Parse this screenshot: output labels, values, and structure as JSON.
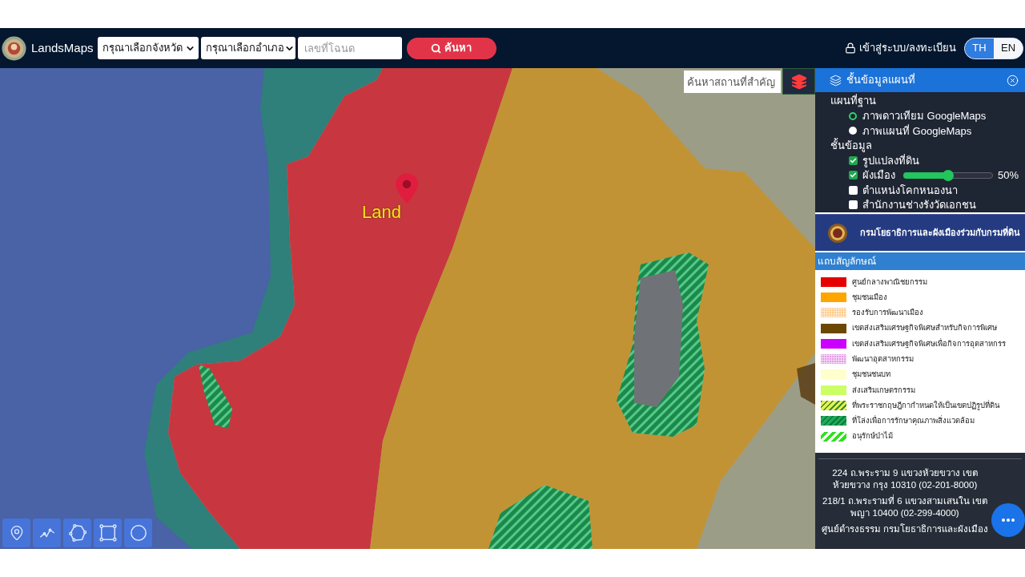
{
  "navbar": {
    "brand": "LandsMaps",
    "province_select": {
      "value": "กรุณาเลือกจังหวัด"
    },
    "district_select": {
      "value": "กรุณาเลือกอำเภอ"
    },
    "deed_number": {
      "placeholder": "เลขที่โฉนด"
    },
    "search_button": "ค้นหา",
    "login_link": "เข้าสู่ระบบ/ลงทะเบียน",
    "languages": [
      {
        "label": "TH",
        "selected": true
      },
      {
        "label": "EN",
        "selected": false
      }
    ]
  },
  "map": {
    "search": {
      "placeholder": "ค้นหาสถานที่สำคัญ"
    },
    "marker": {
      "label": "Land"
    }
  },
  "layers_panel": {
    "title": "ชั้นข้อมูลแผนที่",
    "base_map": {
      "heading": "แผนที่ฐาน",
      "options": [
        {
          "label": "ภาพดาวเทียม GoogleMaps",
          "selected": true
        },
        {
          "label": "ภาพแผนที่ GoogleMaps",
          "selected": false
        }
      ]
    },
    "data_layers": {
      "heading": "ชั้นข้อมูล",
      "items": [
        {
          "label": "รูปแปลงที่ดิน",
          "checked": true
        },
        {
          "label": "ผังเมือง",
          "checked": true,
          "slider": {
            "level": 0.5,
            "reading": "50%"
          }
        },
        {
          "label": "ตำแหน่งโคกหนองนา",
          "checked": false
        },
        {
          "label": "สำนักงานช่างรังวัดเอกชน",
          "checked": false
        }
      ]
    }
  },
  "banner": {
    "text": "กรมโยธาธิการและผังเมืองร่วมกับกรมที่ดิน"
  },
  "legend": {
    "title": "แถบสัญลักษณ์",
    "items": [
      {
        "label": "ศูนย์กลางพาณิชยกรรม",
        "kind": "solid",
        "color": "#e60000"
      },
      {
        "label": "ชุมชนเมือง",
        "kind": "solid",
        "color": "#ffa500"
      },
      {
        "label": "รองรับการพัฒนาเมือง",
        "kind": "dotted",
        "color": "#ffc98a"
      },
      {
        "label": "เขตส่งเสริมเศรษฐกิจพิเศษสำหรับกิจการพิเศษ",
        "kind": "solid",
        "color": "#6b4700"
      },
      {
        "label": "เขตส่งเสริมเศรษฐกิจพิเศษเพื่อกิจการอุตสาหกรร",
        "kind": "solid",
        "color": "#cc00ff"
      },
      {
        "label": "พัฒนาอุตสาหกรรม",
        "kind": "dotted",
        "color": "#e49be6"
      },
      {
        "label": "ชุมชนชนบท",
        "kind": "solid",
        "color": "#ffffcc"
      },
      {
        "label": "ส่งเสริมเกษตรกรรม",
        "kind": "solid",
        "color": "#ccff66"
      },
      {
        "label": "ที่พระราชกฤษฎีกากำหนดให้เป็นเขตปฏิรูปที่ดิน",
        "kind": "hatched",
        "color": "#e6f04a"
      },
      {
        "label": "ที่โล่งเพื่อการรักษาคุณภาพสิ่งแวดล้อม",
        "kind": "hatched",
        "color": "#22a85c"
      },
      {
        "label": "อนุรักษ์ป่าไม้",
        "kind": "striped",
        "color": "#33dd22"
      }
    ]
  },
  "footer": {
    "addresses": [
      "224 ถ.พระราม 9 แขวงห้วยขวาง เขตห้วยขวาง กรุง 10310 (02-201-8000)",
      "218/1 ถ.พระรามที่ 6 แขวงสามเสนใน เขตพญา 10400 (02-299-4000)",
      "ศูนย์ดำรงธรรม กรมโยธาธิการและผังเมือง"
    ]
  }
}
